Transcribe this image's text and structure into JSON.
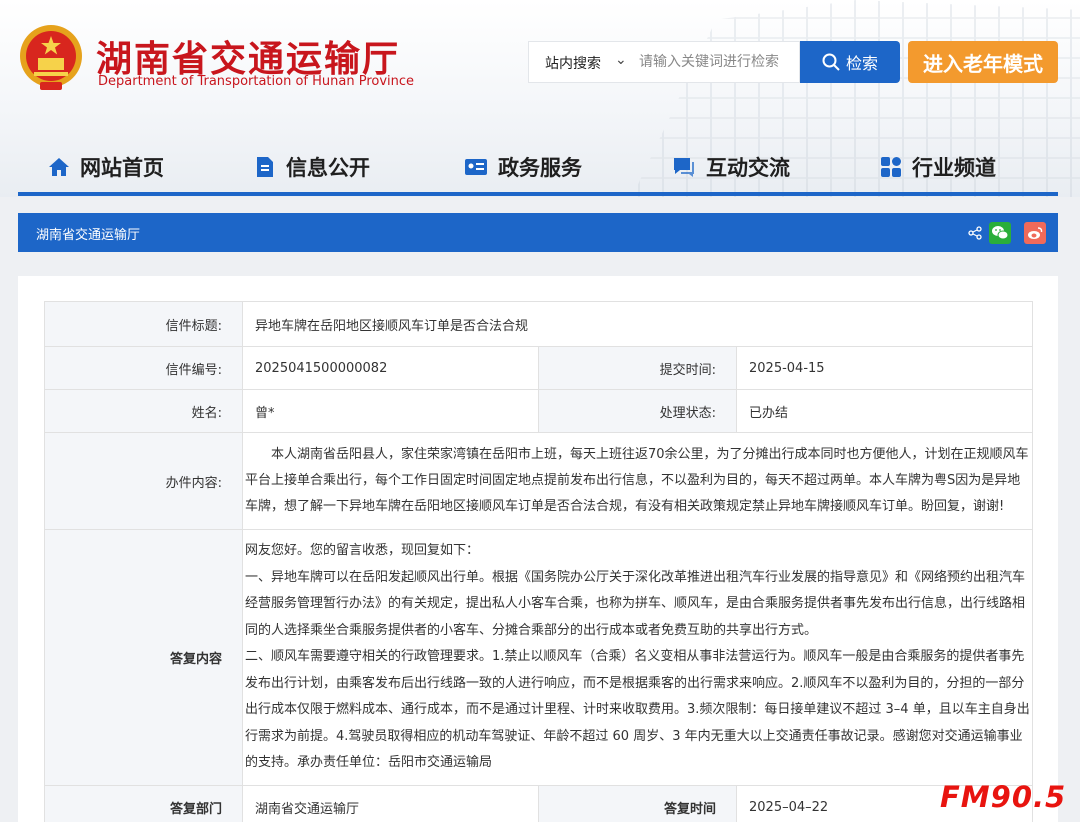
{
  "header": {
    "title_cn": "湖南省交通运输厅",
    "title_en": "Department of Transportation of Hunan Province"
  },
  "search": {
    "category": "站内搜索",
    "placeholder": "请输入关键词进行检索",
    "button_label": "检索"
  },
  "elder_mode_label": "进入老年模式",
  "nav": {
    "items": [
      {
        "label": "网站首页",
        "icon": "home-icon"
      },
      {
        "label": "信息公开",
        "icon": "document-icon"
      },
      {
        "label": "政务服务",
        "icon": "service-card-icon"
      },
      {
        "label": "互动交流",
        "icon": "chat-icon"
      },
      {
        "label": "行业频道",
        "icon": "grid-icon"
      }
    ]
  },
  "breadcrumb": "湖南省交通运输厅",
  "share_icons": [
    "share-icon",
    "wechat-icon",
    "weibo-icon"
  ],
  "letter": {
    "title_label": "信件标题:",
    "title_value": "异地车牌在岳阳地区接顺风车订单是否合法合规",
    "number_label": "信件编号:",
    "number_value": "2025041500000082",
    "submit_label": "提交时间:",
    "submit_value": "2025-04-15",
    "name_label": "姓名:",
    "name_value": "曾*",
    "status_label": "处理状态:",
    "status_value": "已办结",
    "content_label": "办件内容:",
    "content_value": "本人湖南省岳阳县人，家住荣家湾镇在岳阳市上班，每天上班往返70余公里，为了分摊出行成本同时也方便他人，计划在正规顺风车平台上接单合乘出行，每个工作日固定时间固定地点提前发布出行信息，不以盈利为目的，每天不超过两单。本人车牌为粤S因为是异地车牌，想了解一下异地车牌在岳阳地区接顺风车订单是否合法合规，有没有相关政策规定禁止异地车牌接顺风车订单。盼回复，谢谢!",
    "reply_label": "答复内容",
    "reply_value": "网友您好。您的留言收悉，现回复如下：\n一、异地车牌可以在岳阳发起顺风出行单。根据《国务院办公厅关于深化改革推进出租汽车行业发展的指导意见》和《网络预约出租汽车经营服务管理暂行办法》的有关规定，提出私人小客车合乘，也称为拼车、顺风车，是由合乘服务提供者事先发布出行信息，出行线路相同的人选择乘坐合乘服务提供者的小客车、分摊合乘部分的出行成本或者免费互助的共享出行方式。\n二、顺风车需要遵守相关的行政管理要求。1.禁止以顺风车（合乘）名义变相从事非法营运行为。顺风车一般是由合乘服务的提供者事先发布出行计划，由乘客发布后出行线路一致的人进行响应，而不是根据乘客的出行需求来响应。2.顺风车不以盈利为目的，分担的一部分出行成本仅限于燃料成本、通行成本，而不是通过计里程、计时来收取费用。3.频次限制：每日接单建议不超过 3–4 单，且以车主自身出行需求为前提。4.驾驶员取得相应的机动车驾驶证、年龄不超过 60 周岁、3 年内无重大以上交通责任事故记录。感谢您对交通运输事业的支持。承办责任单位：岳阳市交通运输局",
    "dept_label": "答复部门",
    "dept_value": "湖南省交通运输厅",
    "reply_time_label": "答复时间",
    "reply_time_value": "2025–04–22"
  },
  "watermark": "FM90.5",
  "colors": {
    "brand_red": "#c8161d",
    "brand_blue": "#1d66c8",
    "elder_orange": "#f39a2e",
    "watermark_red": "#e8140f"
  }
}
